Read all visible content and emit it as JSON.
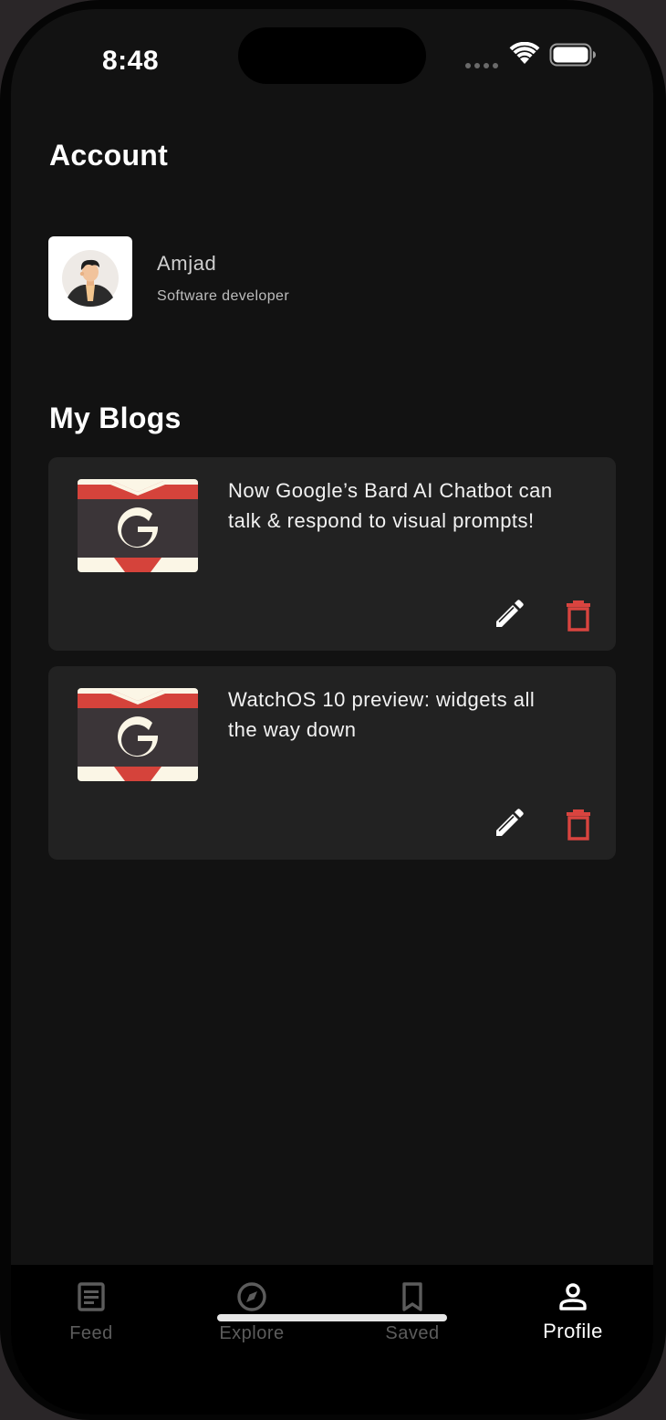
{
  "status_bar": {
    "time": "8:48"
  },
  "account": {
    "heading": "Account",
    "name": "Amjad",
    "role": "Software developer"
  },
  "blogs": {
    "heading": "My Blogs",
    "items": [
      {
        "title_line1": "Now Google’s Bard AI Chatbot can",
        "title_line2": "talk & respond to visual prompts!"
      },
      {
        "title_line1": "WatchOS 10 preview: widgets all",
        "title_line2": "the way down"
      }
    ]
  },
  "nav": {
    "items": [
      {
        "label": "Feed",
        "icon": "document-icon"
      },
      {
        "label": "Explore",
        "icon": "compass-icon"
      },
      {
        "label": "Saved",
        "icon": "bookmark-icon"
      },
      {
        "label": "Profile",
        "icon": "person-icon"
      }
    ],
    "active": "Profile"
  },
  "colors": {
    "background": "#121212",
    "card": "#222222",
    "delete_accent": "#d9443f",
    "nav_inactive": "#5c5c5c"
  }
}
